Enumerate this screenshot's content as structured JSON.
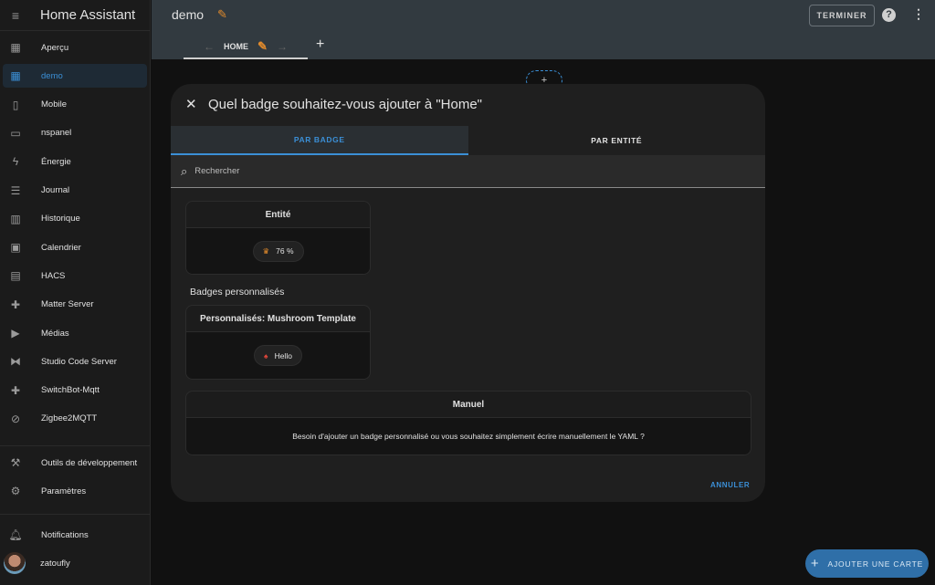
{
  "sidebar": {
    "title": "Home Assistant",
    "items": [
      {
        "label": "Aperçu",
        "icon": "view-dashboard-icon",
        "glyph": "▦"
      },
      {
        "label": "demo",
        "icon": "view-dashboard-icon",
        "glyph": "▦",
        "active": true
      },
      {
        "label": "Mobile",
        "icon": "cellphone-icon",
        "glyph": "▯"
      },
      {
        "label": "nspanel",
        "icon": "tablet-icon",
        "glyph": "▭"
      },
      {
        "label": "Énergie",
        "icon": "lightning-icon",
        "glyph": "ϟ"
      },
      {
        "label": "Journal",
        "icon": "list-icon",
        "glyph": "☰"
      },
      {
        "label": "Historique",
        "icon": "chart-box-icon",
        "glyph": "▥"
      },
      {
        "label": "Calendrier",
        "icon": "calendar-icon",
        "glyph": "▣"
      },
      {
        "label": "HACS",
        "icon": "hacs-icon",
        "glyph": "▤"
      },
      {
        "label": "Matter Server",
        "icon": "puzzle-icon",
        "glyph": "✚"
      },
      {
        "label": "Médias",
        "icon": "play-box-icon",
        "glyph": "▶"
      },
      {
        "label": "Studio Code Server",
        "icon": "vscode-icon",
        "glyph": "⧓"
      },
      {
        "label": "SwitchBot-Mqtt",
        "icon": "puzzle-icon",
        "glyph": "✚"
      },
      {
        "label": "Zigbee2MQTT",
        "icon": "compass-icon",
        "glyph": "⊘"
      }
    ],
    "bottom": [
      {
        "label": "Outils de développement",
        "icon": "hammer-icon",
        "glyph": "⚒"
      },
      {
        "label": "Paramètres",
        "icon": "cog-icon",
        "glyph": "⚙"
      }
    ],
    "notifications": "Notifications",
    "user": "zatoufly"
  },
  "header": {
    "title": "demo",
    "view_tab": "HOME",
    "done_label": "TERMINER"
  },
  "dialog": {
    "title": "Quel badge souhaitez-vous ajouter à \"Home\"",
    "tabs": [
      "PAR BADGE",
      "PAR ENTITÉ"
    ],
    "search_placeholder": "Rechercher",
    "entity_card": {
      "title": "Entité",
      "chip_value": "76 %",
      "icon": "lightbulb-group-icon",
      "icon_color": "#e08a2c"
    },
    "custom_section": "Badges personnalisés",
    "custom_card": {
      "title": "Personnalisés: Mushroom Template",
      "chip_value": "Hello",
      "icon": "mushroom-icon",
      "icon_color": "#e0463a"
    },
    "manual_card": {
      "title": "Manuel",
      "text": "Besoin d'ajouter un badge personnalisé ou vous souhaitez simplement écrire manuellement le YAML ?"
    },
    "cancel_label": "ANNULER"
  },
  "fab_label": "AJOUTER UNE CARTE",
  "colors": {
    "accent": "#3b8fd6",
    "pencil": "#e08a2c",
    "header": "#323a40"
  }
}
